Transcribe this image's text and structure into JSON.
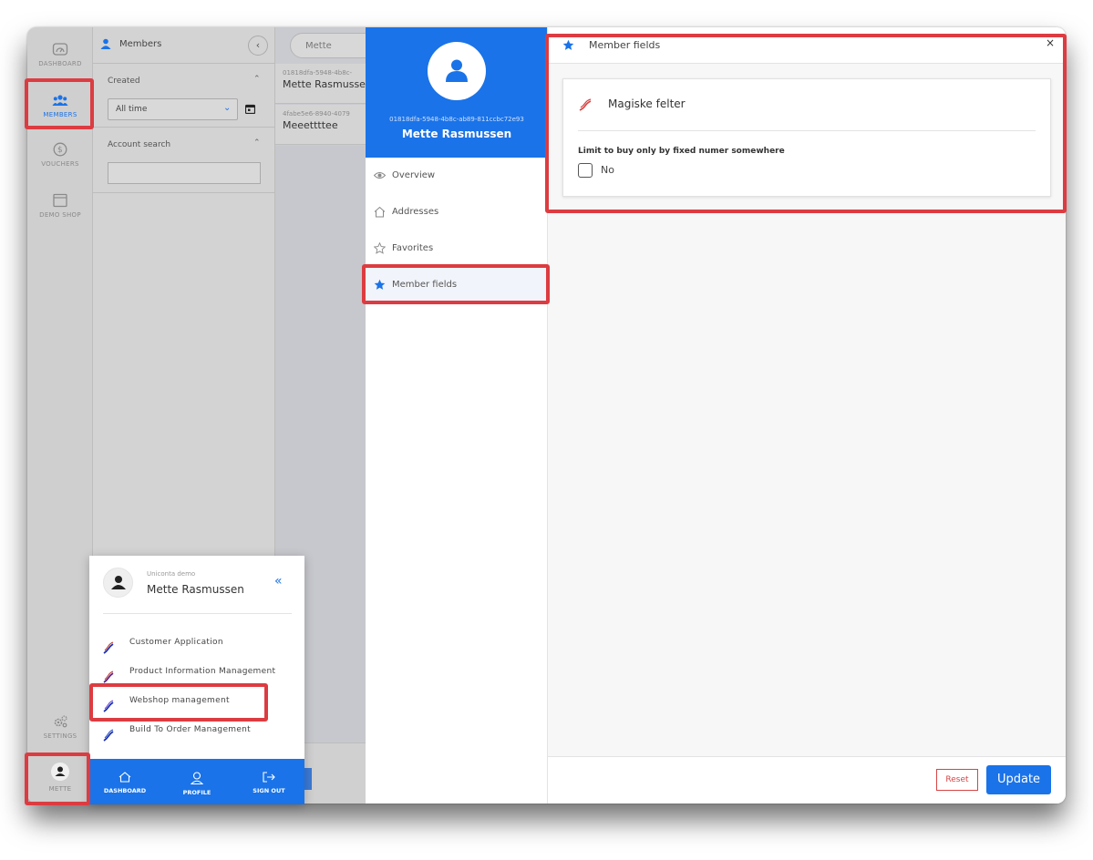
{
  "rail": {
    "items": [
      {
        "label": "DASHBOARD",
        "icon": "dashboard-gauge-icon"
      },
      {
        "label": "MEMBERS",
        "icon": "members-group-icon"
      },
      {
        "label": "VOUCHERS",
        "icon": "dollar-coin-icon"
      },
      {
        "label": "DEMO SHOP",
        "icon": "shop-window-icon"
      },
      {
        "label": "SETTINGS",
        "icon": "gears-icon"
      },
      {
        "label": "METTE",
        "icon": "user-avatar-icon"
      }
    ]
  },
  "filters": {
    "title": "Members",
    "created_label": "Created",
    "created_value": "All time",
    "account_search_label": "Account search",
    "account_search_value": ""
  },
  "list": {
    "search_value": "Mette",
    "rows": [
      {
        "id": "01818dfa-5948-4b8c-",
        "name": "Mette Rasmusse"
      },
      {
        "id": "4fabe5e6-8940-4079",
        "name": "Meeettttee"
      }
    ]
  },
  "profile": {
    "id": "01818dfa-5948-4b8c-ab89-811ccbc72e93",
    "name": "Mette Rasmussen",
    "nav": [
      {
        "label": "Overview",
        "icon": "eye-icon"
      },
      {
        "label": "Addresses",
        "icon": "home-icon"
      },
      {
        "label": "Favorites",
        "icon": "star-outline-icon"
      },
      {
        "label": "Member fields",
        "icon": "star-filled-icon"
      }
    ]
  },
  "main": {
    "title": "Member fields",
    "close": "×",
    "card_title": "Magiske felter",
    "field_label": "Limit to buy only by fixed numer somewhere",
    "checkbox_label": "No",
    "reset_label": "Reset",
    "update_label": "Update"
  },
  "popup": {
    "org": "Uniconta demo",
    "user": "Mette Rasmussen",
    "collapse": "«",
    "apps": [
      "Customer Application",
      "Product Information Management",
      "Webshop management",
      "Build To Order Management"
    ],
    "bar": [
      "DASHBOARD",
      "PROFILE",
      "SIGN OUT"
    ]
  },
  "colors": {
    "accent": "#1a73e8",
    "highlight": "#dc3c41"
  }
}
